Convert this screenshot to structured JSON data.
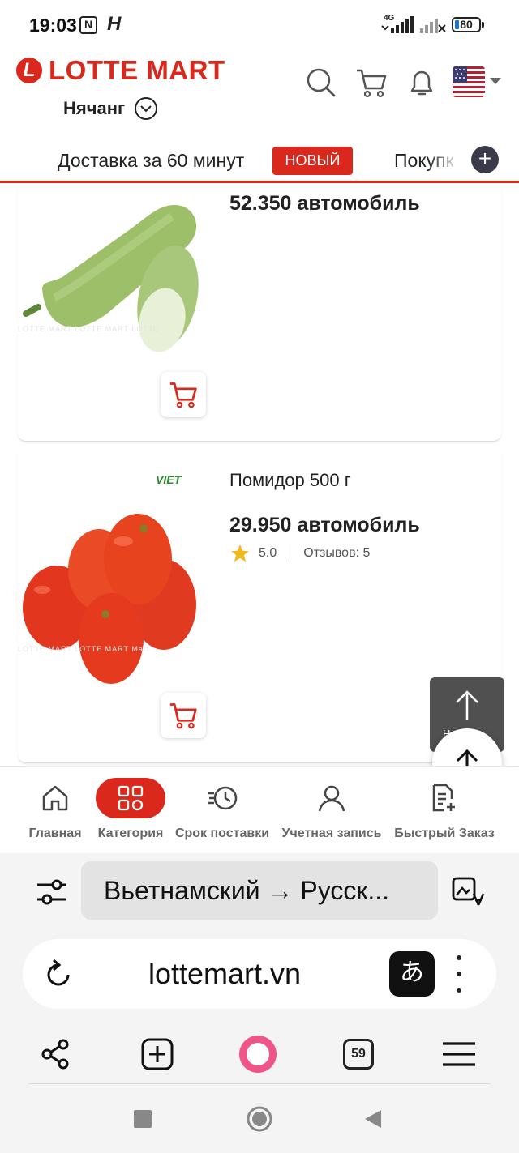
{
  "status_bar": {
    "time": "19:03",
    "network": "4G",
    "battery": "80",
    "icons": [
      "nfc-icon",
      "h-icon",
      "signal-icon",
      "signal-x-icon",
      "battery-icon"
    ]
  },
  "header": {
    "logo_text": "LOTTE MART",
    "logo_mark": "L",
    "city": "Нячанг",
    "icons": [
      "search-icon",
      "cart-icon",
      "bell-icon",
      "us-flag-icon"
    ]
  },
  "delivery_bar": {
    "text": "Доставка за 60 минут",
    "badge": "НОВЫЙ",
    "tab_next": "Покупки"
  },
  "products": [
    {
      "name": "",
      "price": "52.350 автомобиль",
      "watermark": "LOTTE MART  LOTTE MART  LOTTE",
      "image": "zucchini"
    },
    {
      "name": "Помидор 500 г",
      "price": "29.950 автомобиль",
      "rating": "5.0",
      "reviews": "Отзывов: 5",
      "brand": "VIET",
      "watermark": "LOTTE MART  LOTTE MART  Mart",
      "image": "tomatoes"
    }
  ],
  "scroll_top": {
    "label": "Наверх"
  },
  "app_nav": {
    "items": [
      {
        "label": "Главная",
        "icon": "home-icon"
      },
      {
        "label": "Категория",
        "icon": "grid-icon",
        "active": true
      },
      {
        "label": "Срок поставки",
        "icon": "delivery-clock-icon"
      },
      {
        "label": "Учетная запись",
        "icon": "user-icon"
      },
      {
        "label": "Быстрый Заказ",
        "icon": "quick-order-icon"
      }
    ],
    "active_color": "#da291c"
  },
  "browser": {
    "translate_label": "Вьетнамский → Русск...",
    "url": "lottemart.vn",
    "translate_badge": "あ",
    "tabs_count": "59"
  },
  "colors": {
    "brand": "#da291c",
    "dark": "#3a3a4a"
  }
}
